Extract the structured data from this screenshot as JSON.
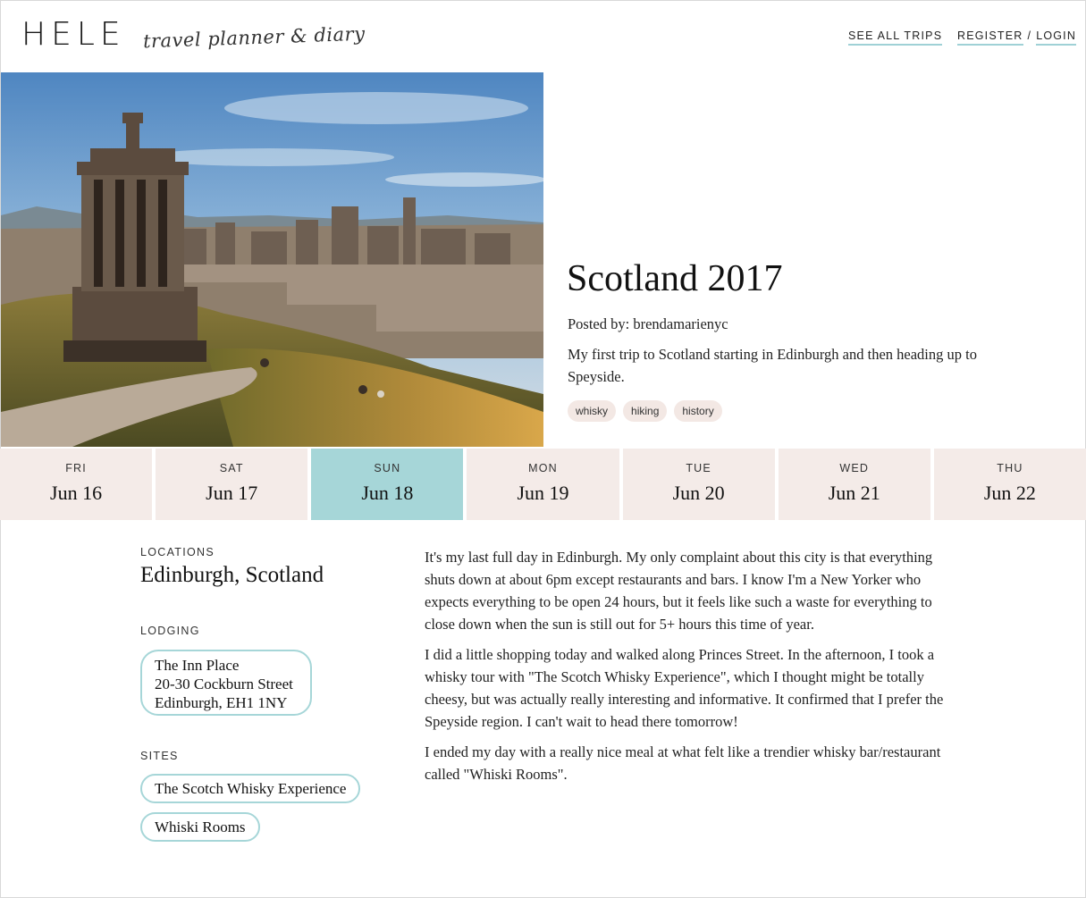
{
  "header": {
    "logo": "HELE",
    "tagline": "travel planner & diary",
    "nav_trips": "SEE ALL TRIPS",
    "nav_register": "REGISTER",
    "nav_separator": "/",
    "nav_login": "LOGIN"
  },
  "trip": {
    "title": "Scotland 2017",
    "posted_by": "Posted by: brendamarienyc",
    "description": "My first trip to Scotland starting in Edinburgh and then heading up to Speyside.",
    "tags": [
      "whisky",
      "hiking",
      "history"
    ]
  },
  "days": [
    {
      "dow": "FRI",
      "date": "Jun 16",
      "active": false
    },
    {
      "dow": "SAT",
      "date": "Jun 17",
      "active": false
    },
    {
      "dow": "SUN",
      "date": "Jun 18",
      "active": true
    },
    {
      "dow": "MON",
      "date": "Jun 19",
      "active": false
    },
    {
      "dow": "TUE",
      "date": "Jun 20",
      "active": false
    },
    {
      "dow": "WED",
      "date": "Jun 21",
      "active": false
    },
    {
      "dow": "THU",
      "date": "Jun 22",
      "active": false
    }
  ],
  "details": {
    "locations_label": "LOCATIONS",
    "location": "Edinburgh, Scotland",
    "lodging_label": "LODGING",
    "lodging": {
      "name": "The Inn Place",
      "street": "20-30 Cockburn Street",
      "city": "Edinburgh, EH1 1NY"
    },
    "sites_label": "SITES",
    "sites": [
      "The Scotch Whisky Experience",
      "Whiski Rooms"
    ]
  },
  "journal": [
    "It's my last full day in Edinburgh. My only complaint about this city is that everything shuts down at about 6pm except restaurants and bars. I know I'm a New Yorker who expects everything to be open 24 hours, but it feels like such a waste for everything to close down when the sun is still out for 5+ hours this time of year.",
    "I did a little shopping today and walked along Princes Street. In the afternoon, I took a whisky tour with \"The Scotch Whisky Experience\", which I thought might be totally cheesy, but was actually really interesting and informative. It confirmed that I prefer the Speyside region. I can't wait to head there tomorrow!",
    "I ended my day with a really nice meal at what felt like a trendier whisky bar/restaurant called \"Whiski Rooms\"."
  ],
  "colors": {
    "accent": "#a6d6d8",
    "day_bg": "#f4ebe8",
    "tag_bg": "#f3e8e4"
  }
}
